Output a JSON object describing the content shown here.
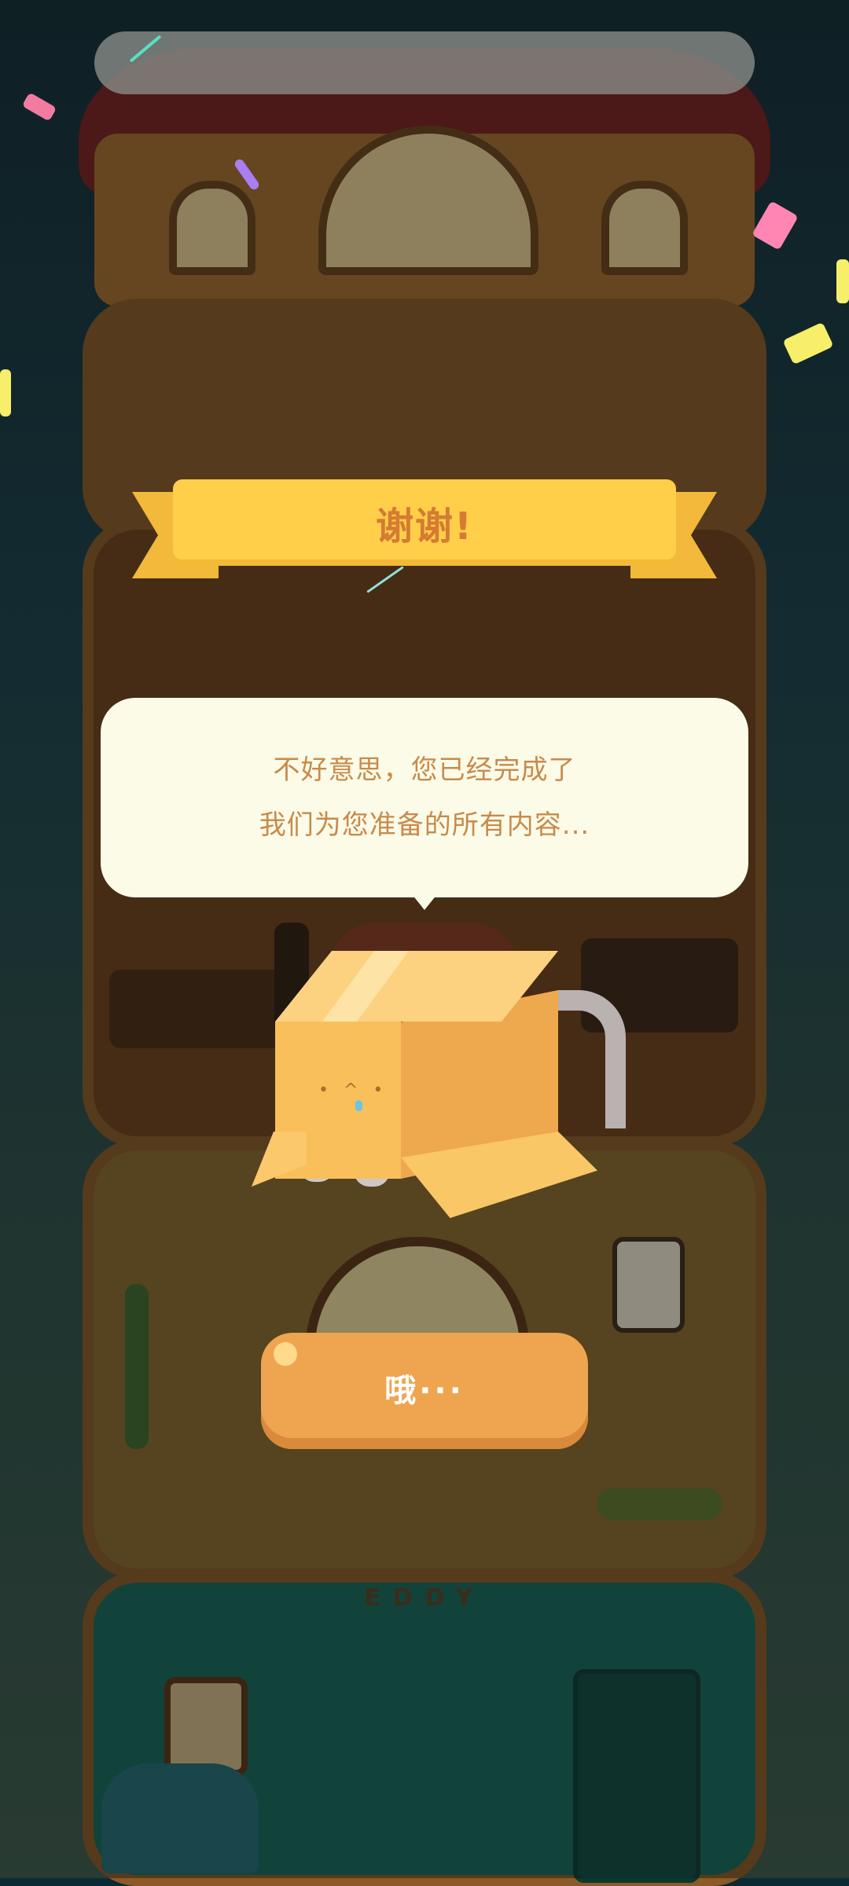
{
  "banner": {
    "title": "谢谢!"
  },
  "bubble": {
    "line1": "不好意思，您已经完成了",
    "line2": "我们为您准备的所有内容..."
  },
  "button": {
    "label": "哦···"
  },
  "background": {
    "room_sign": "EDDY"
  },
  "colors": {
    "banner": "#ffcf4a",
    "banner_text": "#d57b33",
    "bubble_bg": "#fbfbe8",
    "bubble_text": "#c98a4a",
    "button": "#efa550"
  },
  "icons": [
    "cardboard-box-cat-icon"
  ]
}
